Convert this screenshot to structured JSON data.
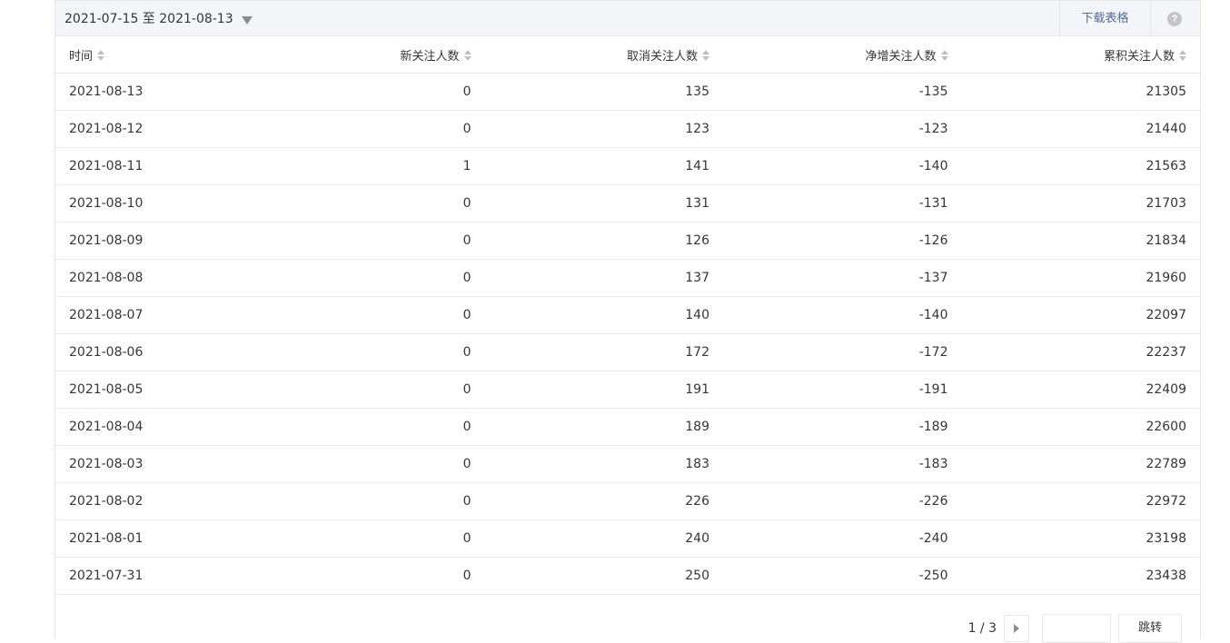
{
  "toolbar": {
    "date_range": "2021-07-15 至 2021-08-13",
    "download_label": "下载表格",
    "help_label": "?"
  },
  "table": {
    "columns": [
      "时间",
      "新关注人数",
      "取消关注人数",
      "净增关注人数",
      "累积关注人数"
    ],
    "rows": [
      [
        "2021-08-13",
        "0",
        "135",
        "-135",
        "21305"
      ],
      [
        "2021-08-12",
        "0",
        "123",
        "-123",
        "21440"
      ],
      [
        "2021-08-11",
        "1",
        "141",
        "-140",
        "21563"
      ],
      [
        "2021-08-10",
        "0",
        "131",
        "-131",
        "21703"
      ],
      [
        "2021-08-09",
        "0",
        "126",
        "-126",
        "21834"
      ],
      [
        "2021-08-08",
        "0",
        "137",
        "-137",
        "21960"
      ],
      [
        "2021-08-07",
        "0",
        "140",
        "-140",
        "22097"
      ],
      [
        "2021-08-06",
        "0",
        "172",
        "-172",
        "22237"
      ],
      [
        "2021-08-05",
        "0",
        "191",
        "-191",
        "22409"
      ],
      [
        "2021-08-04",
        "0",
        "189",
        "-189",
        "22600"
      ],
      [
        "2021-08-03",
        "0",
        "183",
        "-183",
        "22789"
      ],
      [
        "2021-08-02",
        "0",
        "226",
        "-226",
        "22972"
      ],
      [
        "2021-08-01",
        "0",
        "240",
        "-240",
        "23198"
      ],
      [
        "2021-07-31",
        "0",
        "250",
        "-250",
        "23438"
      ]
    ]
  },
  "pagination": {
    "page_indicator": "1 / 3",
    "jump_input_value": "",
    "jump_label": "跳转"
  }
}
